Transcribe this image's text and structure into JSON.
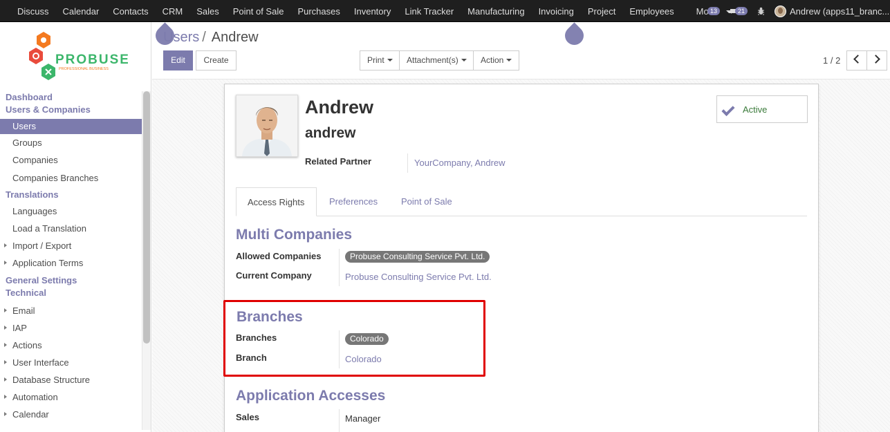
{
  "topbar": {
    "apps": [
      "Discuss",
      "Calendar",
      "Contacts",
      "CRM",
      "Sales",
      "Point of Sale",
      "Purchases",
      "Inventory",
      "Link Tracker",
      "Manufacturing",
      "Invoicing",
      "Project",
      "Employees"
    ],
    "more_label": "More",
    "messages_count": "13",
    "chat_count": "21",
    "user_label": "Andrew (apps11_branc..."
  },
  "logo": {
    "brand": "PROBUSE",
    "tagline": "PROFESSIONAL BUSINESS"
  },
  "sidebar": {
    "dashboard": "Dashboard",
    "users_companies": "Users & Companies",
    "users": "Users",
    "groups": "Groups",
    "companies": "Companies",
    "companies_branches": "Companies Branches",
    "translations": "Translations",
    "languages": "Languages",
    "load_translation": "Load a Translation",
    "import_export": "Import / Export",
    "app_terms": "Application Terms",
    "general_settings": "General Settings",
    "technical": "Technical",
    "email": "Email",
    "iap": "IAP",
    "actions": "Actions",
    "user_interface": "User Interface",
    "database_structure": "Database Structure",
    "automation": "Automation",
    "calendar": "Calendar"
  },
  "breadcrumb": {
    "parent": "Users",
    "current": "Andrew"
  },
  "toolbar": {
    "edit": "Edit",
    "create": "Create",
    "print": "Print",
    "attachments": "Attachment(s)",
    "action": "Action"
  },
  "pager": {
    "value": "1 / 2"
  },
  "record": {
    "name": "Andrew",
    "login": "andrew",
    "related_partner_label": "Related Partner",
    "related_partner_value": "YourCompany, Andrew",
    "active_label": "Active"
  },
  "tabs": [
    "Access Rights",
    "Preferences",
    "Point of Sale"
  ],
  "multi_companies": {
    "title": "Multi Companies",
    "allowed_label": "Allowed Companies",
    "allowed_tag": "Probuse Consulting Service Pvt. Ltd.",
    "current_label": "Current Company",
    "current_value": "Probuse Consulting Service Pvt. Ltd."
  },
  "branches": {
    "title": "Branches",
    "branches_label": "Branches",
    "branches_tag": "Colorado",
    "branch_label": "Branch",
    "branch_value": "Colorado"
  },
  "app_accesses": {
    "title": "Application Accesses",
    "sales_label": "Sales",
    "sales_value": "Manager"
  },
  "colors": {
    "accent": "#7c7bad",
    "highlight": "#e00000",
    "topbar": "#1f1f1f"
  }
}
